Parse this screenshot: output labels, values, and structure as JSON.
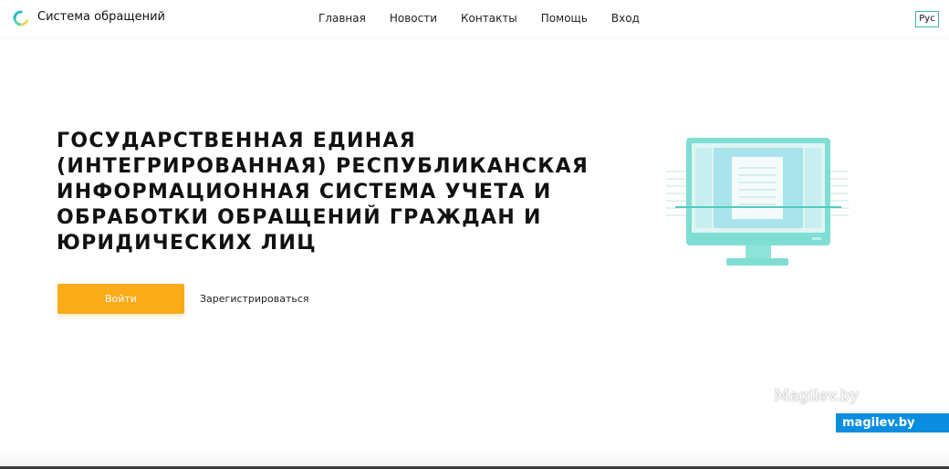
{
  "header": {
    "brand": "Система обращений",
    "nav": [
      {
        "label": "Главная"
      },
      {
        "label": "Новости"
      },
      {
        "label": "Контакты"
      },
      {
        "label": "Помощь"
      },
      {
        "label": "Вход"
      }
    ],
    "language": "Рус"
  },
  "hero": {
    "title": "Государственная единая (интегрированная) республиканская информационная система учета и обработки обращений граждан и юридических лиц",
    "login_button": "Войти",
    "register_link": "Зарегистрироваться"
  },
  "watermarks": {
    "overlay_text": "Magilev.by",
    "badge_text": "magilev.by"
  },
  "colors": {
    "accent_orange": "#fbab18",
    "teal": "#5fd3c6",
    "badge_blue": "#0c8ee0"
  },
  "icons": {
    "logo": "ring-logo-icon",
    "illustration": "monitor-document-icon"
  }
}
